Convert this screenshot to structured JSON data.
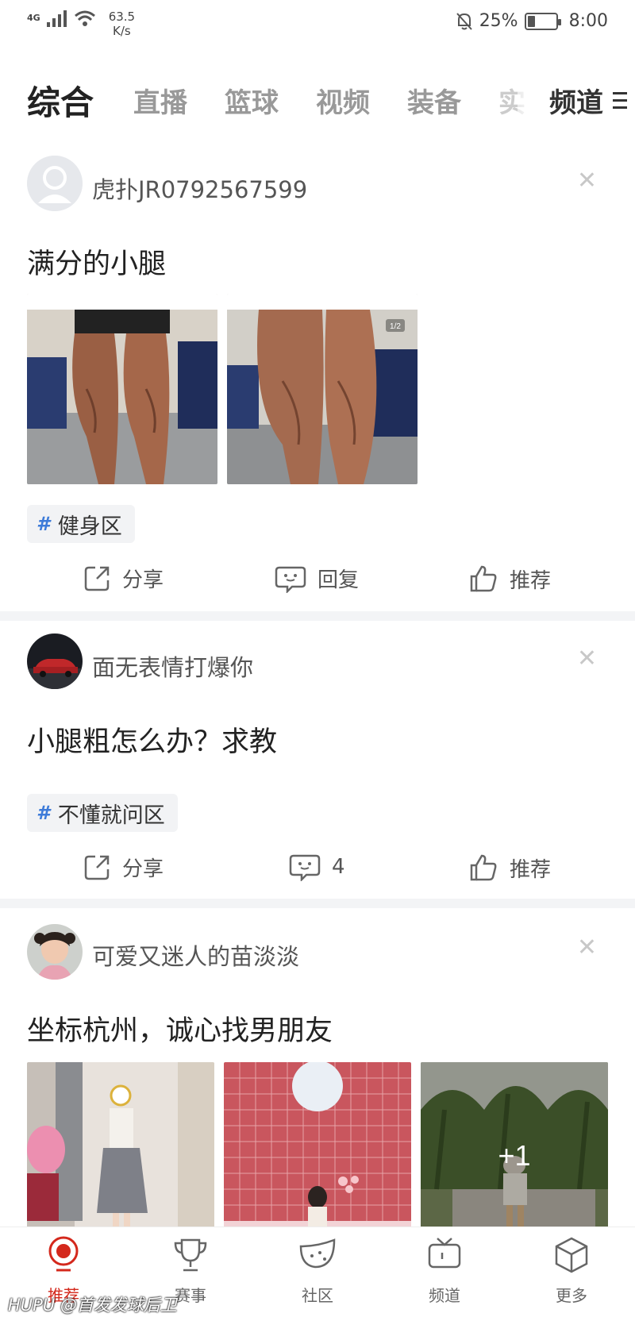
{
  "status_bar": {
    "network": "4G",
    "speed_value": "63.5",
    "speed_unit": "K/s",
    "battery": "25%",
    "battery_level": 0.25,
    "time": "8:00"
  },
  "tabs": {
    "items": [
      "综合",
      "直播",
      "篮球",
      "视频",
      "装备",
      "实"
    ],
    "active_index": 0,
    "channel_label": "频道"
  },
  "posts": [
    {
      "username": "虎扑JR0792567599",
      "title": "满分的小腿",
      "tag": "健身区",
      "actions": {
        "share": "分享",
        "reply": "回复",
        "recommend": "推荐"
      },
      "image_label": "1/2"
    },
    {
      "username": "面无表情打爆你",
      "title": "小腿粗怎么办？求教",
      "tag": "不懂就问区",
      "actions": {
        "share": "分享",
        "reply": "4",
        "recommend": "推荐"
      }
    },
    {
      "username": "可爱又迷人的苗淡淡",
      "title": "坐标杭州，诚心找男朋友",
      "more_images": "+1"
    }
  ],
  "bottom_nav": {
    "items": [
      {
        "label": "推荐",
        "icon": "recommend-icon",
        "active": true
      },
      {
        "label": "赛事",
        "icon": "trophy-icon",
        "active": false
      },
      {
        "label": "社区",
        "icon": "watermelon-icon",
        "active": false
      },
      {
        "label": "频道",
        "icon": "tv-icon",
        "active": false
      },
      {
        "label": "更多",
        "icon": "cube-icon",
        "active": false
      }
    ]
  },
  "watermark": "HUPU @首发发球后卫",
  "colors": {
    "accent": "#d4281c",
    "tag_icon": "#3d7bd9",
    "separator": "#f3f4f6"
  }
}
